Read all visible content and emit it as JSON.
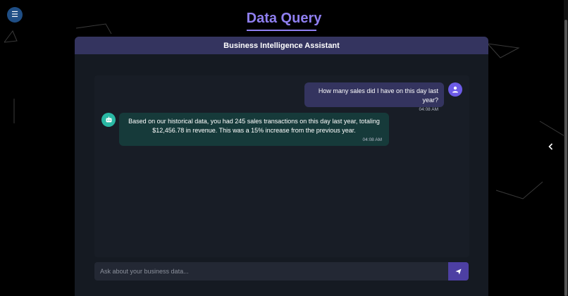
{
  "app": {
    "title": "Data Query"
  },
  "chat": {
    "header_title": "Business Intelligence Assistant",
    "messages": [
      {
        "role": "user",
        "text": "How many sales did I have on this day last year?",
        "time": "04:08 AM"
      },
      {
        "role": "assistant",
        "text": "Based on our historical data, you had 245 sales transactions on this day last year, totaling $12,456.78 in revenue. This was a 15% increase from the previous year.",
        "time": "04:08 AM"
      }
    ],
    "input": {
      "placeholder": "Ask about your business data...",
      "value": ""
    }
  },
  "icons": {
    "menu": "hamburger-icon",
    "user_avatar": "user-icon",
    "bot_avatar": "robot-icon",
    "send": "paper-plane-icon",
    "side_toggle": "chevron-left-icon"
  },
  "colors": {
    "background": "#000000",
    "title_accent": "#8f7ff0",
    "card": "#151a22",
    "card_header": "#34345f",
    "user_bubble": "#34345f",
    "bot_bubble": "#163a3a",
    "user_avatar": "#6c5be6",
    "bot_avatar": "#2ab8a4",
    "send_button": "#4d3fa3",
    "menu_button": "#1f4e85"
  }
}
